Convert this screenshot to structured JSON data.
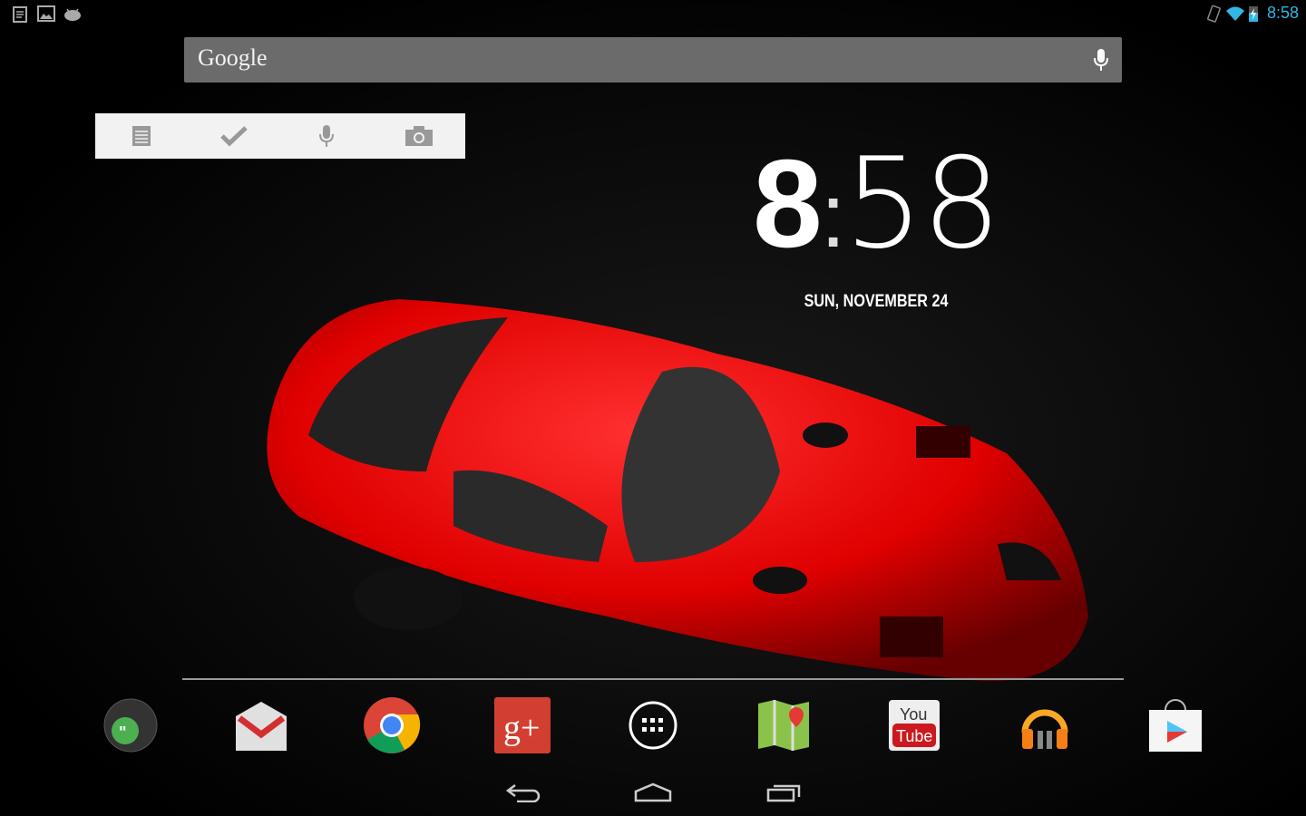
{
  "status_bar": {
    "time": "8:58",
    "left_icons": [
      "clipboard-icon",
      "image-icon",
      "android-icon"
    ],
    "right_icons": [
      "vibrate-icon",
      "wifi-icon",
      "battery-charging-icon"
    ],
    "accent": "#33b5e5"
  },
  "search_bar": {
    "logo": "Google",
    "mic": "mic-icon"
  },
  "keep_widget": {
    "buttons": [
      "note-icon",
      "checklist-icon",
      "mic-icon",
      "camera-icon"
    ]
  },
  "clock_widget": {
    "hour": "8",
    "separator": ":",
    "minutes": "58",
    "date": "SUN, NOVEMBER 24"
  },
  "dock": {
    "apps": [
      "Hangouts",
      "Gmail",
      "Chrome",
      "Google+",
      "All Apps",
      "Maps",
      "YouTube",
      "Play Music",
      "Play Store"
    ],
    "youtube_you": "You",
    "youtube_tube": "Tube"
  },
  "nav_bar": {
    "buttons": [
      "back",
      "home",
      "recents"
    ]
  }
}
